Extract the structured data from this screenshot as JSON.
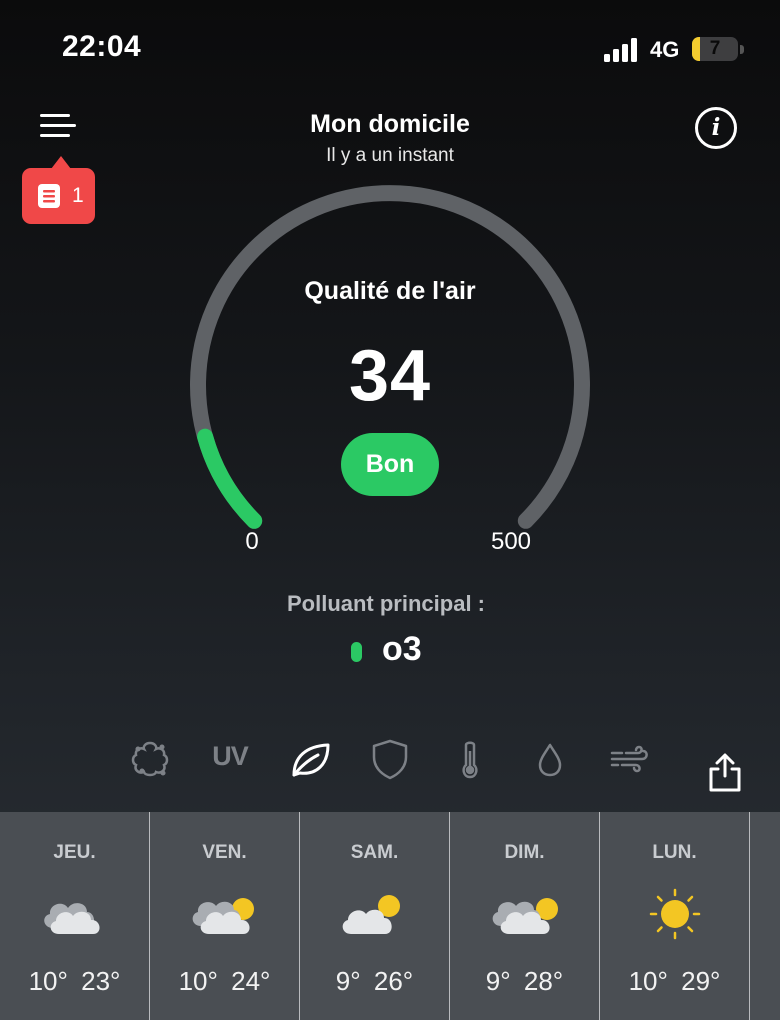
{
  "status_bar": {
    "time": "22:04",
    "network": "4G",
    "battery_level": "7",
    "battery_fraction": 0.07
  },
  "header": {
    "title": "Mon domicile",
    "subtitle": "Il y a un instant",
    "menu_icon": "menu-icon",
    "info_icon": "info-icon",
    "alert_count": "1",
    "alert_icon": "document-icon"
  },
  "air_quality": {
    "label": "Qualité de l'air",
    "value": "34",
    "status": "Bon",
    "scale_min": "0",
    "scale_max": "500",
    "aqi_number": 34,
    "aqi_max": 500,
    "status_color": "#2bc964",
    "track_color": "#5f6266"
  },
  "pollutant": {
    "label": "Polluant principal :",
    "value": "o3",
    "color": "#2bc964"
  },
  "tabs": [
    {
      "icon": "pollen-icon",
      "active": false
    },
    {
      "icon": "uv-icon",
      "label": "UV",
      "active": false
    },
    {
      "icon": "leaf-icon",
      "active": true
    },
    {
      "icon": "shield-icon",
      "active": false
    },
    {
      "icon": "thermometer-icon",
      "active": false
    },
    {
      "icon": "drop-icon",
      "active": false
    },
    {
      "icon": "wind-icon",
      "active": false
    }
  ],
  "share_icon": "share-icon",
  "forecast": [
    {
      "day": "JEU.",
      "icon": "cloudy-icon",
      "temps": "10° 23°"
    },
    {
      "day": "VEN.",
      "icon": "partly-cloudy-icon",
      "temps": "10° 24°"
    },
    {
      "day": "SAM.",
      "icon": "partly-cloudy-icon",
      "temps": "9° 26°"
    },
    {
      "day": "DIM.",
      "icon": "partly-cloudy-icon",
      "temps": "9° 28°"
    },
    {
      "day": "LUN.",
      "icon": "sunny-icon",
      "temps": "10° 29°"
    }
  ]
}
